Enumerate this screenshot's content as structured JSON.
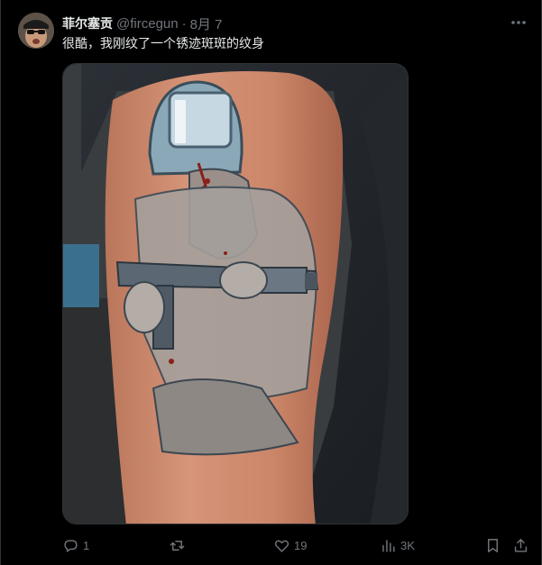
{
  "post": {
    "author": {
      "display_name": "菲尔塞贡",
      "handle": "@fircegun",
      "separator": "·",
      "date": "8月 7"
    },
    "text": "很酷，我刚纹了一个锈迹斑斑的纹身",
    "media": {
      "type": "photo",
      "alt": ""
    },
    "actions": {
      "reply_count": "1",
      "repost_count": "",
      "like_count": "19",
      "views_count": "3K"
    },
    "icons": {
      "more": "more-icon",
      "reply": "reply-icon",
      "repost": "repost-icon",
      "like": "like-icon",
      "views": "views-icon",
      "bookmark": "bookmark-icon",
      "share": "share-icon"
    },
    "colors": {
      "background": "#000000",
      "text": "#e7e9ea",
      "secondary_text": "#71767b",
      "border": "#2f3336"
    }
  }
}
